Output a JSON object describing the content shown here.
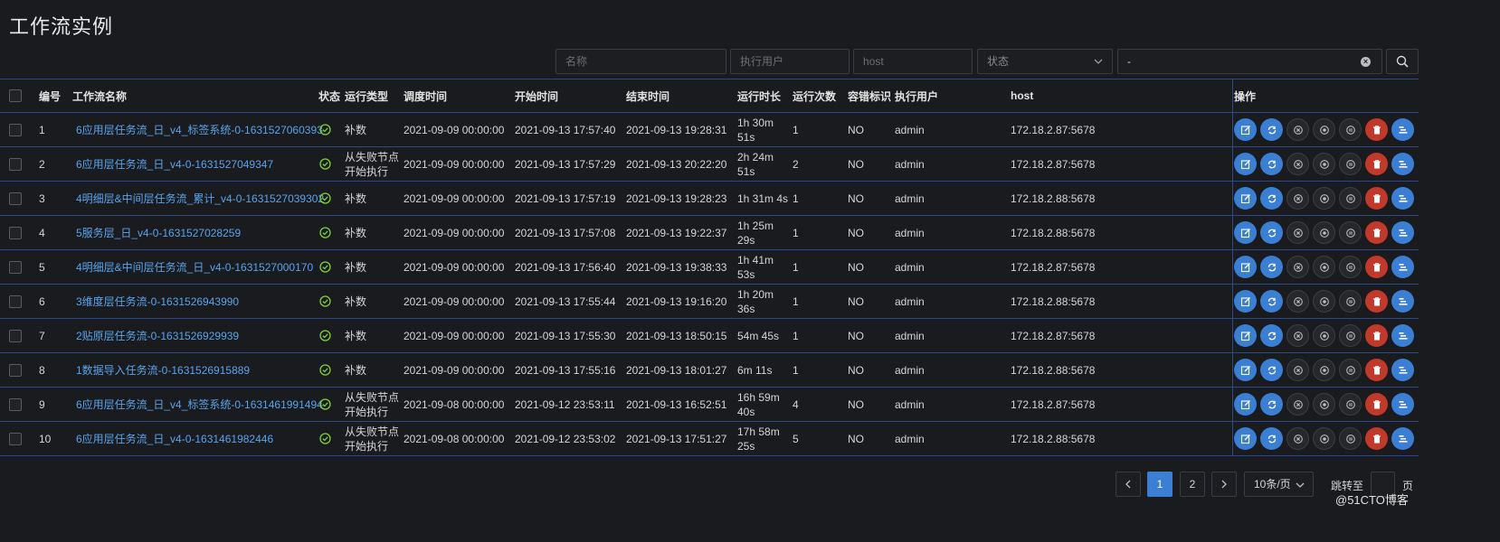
{
  "page": {
    "title": "工作流实例"
  },
  "filters": {
    "name_placeholder": "名称",
    "user_placeholder": "执行用户",
    "host_placeholder": "host",
    "status_placeholder": "状态",
    "date_range_value": "-"
  },
  "columns": {
    "num": "编号",
    "name": "工作流名称",
    "state": "状态",
    "run_type": "运行类型",
    "schedule_time": "调度时间",
    "start_time": "开始时间",
    "end_time": "结束时间",
    "duration": "运行时长",
    "run_times": "运行次数",
    "fault_tolerant": "容错标识",
    "executor": "执行用户",
    "host": "host",
    "operation": "操作"
  },
  "rows": [
    {
      "num": "1",
      "name": "6应用层任务流_日_v4_标签系统-0-1631527060393",
      "run_type": "补数",
      "schedule_time": "2021-09-09 00:00:00",
      "start_time": "2021-09-13 17:57:40",
      "end_time": "2021-09-13 19:28:31",
      "duration": "1h 30m 51s",
      "run_times": "1",
      "fault_tolerant": "NO",
      "executor": "admin",
      "host": "172.18.2.87:5678"
    },
    {
      "num": "2",
      "name": "6应用层任务流_日_v4-0-1631527049347",
      "run_type": "从失败节点开始执行",
      "schedule_time": "2021-09-09 00:00:00",
      "start_time": "2021-09-13 17:57:29",
      "end_time": "2021-09-13 20:22:20",
      "duration": "2h 24m 51s",
      "run_times": "2",
      "fault_tolerant": "NO",
      "executor": "admin",
      "host": "172.18.2.87:5678"
    },
    {
      "num": "3",
      "name": "4明细层&中间层任务流_累计_v4-0-1631527039302",
      "run_type": "补数",
      "schedule_time": "2021-09-09 00:00:00",
      "start_time": "2021-09-13 17:57:19",
      "end_time": "2021-09-13 19:28:23",
      "duration": "1h 31m 4s",
      "run_times": "1",
      "fault_tolerant": "NO",
      "executor": "admin",
      "host": "172.18.2.88:5678"
    },
    {
      "num": "4",
      "name": "5服务层_日_v4-0-1631527028259",
      "run_type": "补数",
      "schedule_time": "2021-09-09 00:00:00",
      "start_time": "2021-09-13 17:57:08",
      "end_time": "2021-09-13 19:22:37",
      "duration": "1h 25m 29s",
      "run_times": "1",
      "fault_tolerant": "NO",
      "executor": "admin",
      "host": "172.18.2.88:5678"
    },
    {
      "num": "5",
      "name": "4明细层&中间层任务流_日_v4-0-1631527000170",
      "run_type": "补数",
      "schedule_time": "2021-09-09 00:00:00",
      "start_time": "2021-09-13 17:56:40",
      "end_time": "2021-09-13 19:38:33",
      "duration": "1h 41m 53s",
      "run_times": "1",
      "fault_tolerant": "NO",
      "executor": "admin",
      "host": "172.18.2.87:5678"
    },
    {
      "num": "6",
      "name": "3维度层任务流-0-1631526943990",
      "run_type": "补数",
      "schedule_time": "2021-09-09 00:00:00",
      "start_time": "2021-09-13 17:55:44",
      "end_time": "2021-09-13 19:16:20",
      "duration": "1h 20m 36s",
      "run_times": "1",
      "fault_tolerant": "NO",
      "executor": "admin",
      "host": "172.18.2.88:5678"
    },
    {
      "num": "7",
      "name": "2贴原层任务流-0-1631526929939",
      "run_type": "补数",
      "schedule_time": "2021-09-09 00:00:00",
      "start_time": "2021-09-13 17:55:30",
      "end_time": "2021-09-13 18:50:15",
      "duration": "54m 45s",
      "run_times": "1",
      "fault_tolerant": "NO",
      "executor": "admin",
      "host": "172.18.2.87:5678"
    },
    {
      "num": "8",
      "name": "1数据导入任务流-0-1631526915889",
      "run_type": "补数",
      "schedule_time": "2021-09-09 00:00:00",
      "start_time": "2021-09-13 17:55:16",
      "end_time": "2021-09-13 18:01:27",
      "duration": "6m 11s",
      "run_times": "1",
      "fault_tolerant": "NO",
      "executor": "admin",
      "host": "172.18.2.88:5678"
    },
    {
      "num": "9",
      "name": "6应用层任务流_日_v4_标签系统-0-1631461991494",
      "run_type": "从失败节点开始执行",
      "schedule_time": "2021-09-08 00:00:00",
      "start_time": "2021-09-12 23:53:11",
      "end_time": "2021-09-13 16:52:51",
      "duration": "16h 59m 40s",
      "run_times": "4",
      "fault_tolerant": "NO",
      "executor": "admin",
      "host": "172.18.2.87:5678"
    },
    {
      "num": "10",
      "name": "6应用层任务流_日_v4-0-1631461982446",
      "run_type": "从失败节点开始执行",
      "schedule_time": "2021-09-08 00:00:00",
      "start_time": "2021-09-12 23:53:02",
      "end_time": "2021-09-13 17:51:27",
      "duration": "17h 58m 25s",
      "run_times": "5",
      "fault_tolerant": "NO",
      "executor": "admin",
      "host": "172.18.2.88:5678"
    }
  ],
  "pagination": {
    "pages": [
      "1",
      "2"
    ],
    "current": "1",
    "page_size": "10条/页",
    "jump_label": "跳转至",
    "page_unit": "页"
  },
  "watermark": "@51CTO博客",
  "colors": {
    "background": "#1a1b1e",
    "accent_blue": "#3b7fd4",
    "link": "#5aa3ec",
    "danger": "#c0392b",
    "success": "#7ccf3c",
    "border": "#2b4a8a"
  },
  "icons": {
    "row_actions": [
      "edit-icon",
      "rerun-icon",
      "stop-icon",
      "pause-icon",
      "resume-icon",
      "delete-icon",
      "gantt-icon"
    ],
    "status": "success-check-icon"
  }
}
